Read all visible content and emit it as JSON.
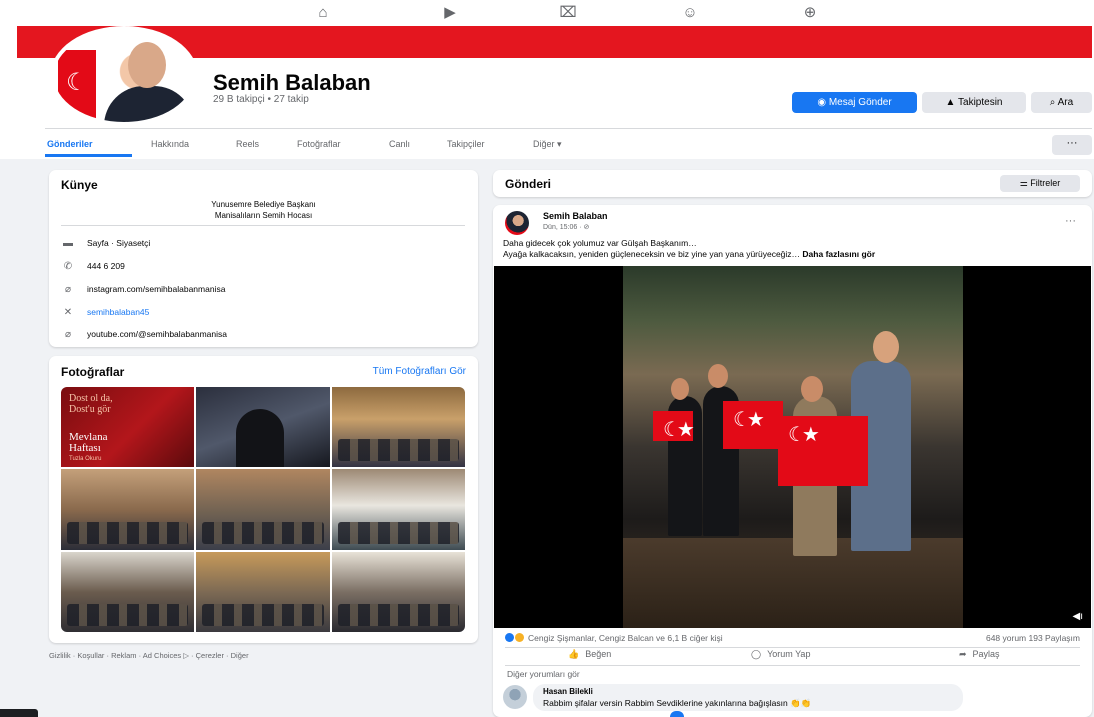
{
  "topnav": {
    "icons": [
      "home-icon",
      "video-icon",
      "marketplace-icon",
      "groups-icon",
      "gaming-icon"
    ]
  },
  "profile": {
    "name": "Semih Balaban",
    "stats": "29 B takipçi • 27 takip",
    "cover_color": "#e4161f"
  },
  "actions": {
    "message": "Mesaj Gönder",
    "following": "Takiptesin",
    "search": "Ara"
  },
  "tabs": [
    "Gönderiler",
    "Hakkında",
    "Reels",
    "Fotoğraflar",
    "Canlı",
    "Takipçiler",
    "Diğer ▾"
  ],
  "about": {
    "title": "Künye",
    "bio_line1": "Yunusemre Belediye Başkanı",
    "bio_line2": "Manisalıların Semih Hocası",
    "rows": [
      {
        "icon": "briefcase-icon",
        "text": "Sayfa · Siyasetçi"
      },
      {
        "icon": "phone-icon",
        "text": "444 6 209"
      },
      {
        "icon": "link-icon",
        "text": "instagram.com/semihbalabanmanisa"
      },
      {
        "icon": "x-icon",
        "text": "semihbalaban45"
      },
      {
        "icon": "link-icon",
        "text": "youtube.com/@semihbalabanmanisa"
      }
    ]
  },
  "photos": {
    "title": "Fotoğraflar",
    "see_all": "Tüm Fotoğrafları Gör",
    "poster_line1": "Dost ol da,",
    "poster_line2": "Dost'u gör",
    "poster_title1": "Mevlana",
    "poster_title2": "Haftası",
    "poster_sub": "Tuzla Okuru"
  },
  "footer": "Gizlilik · Koşullar · Reklam · Ad Choices ▷ · Çerezler · Diğer",
  "posts": {
    "title": "Gönderi",
    "filters": "Filtreler"
  },
  "post": {
    "author": "Semih Balaban",
    "time": "Dün, 15:06 · ⊘",
    "line1": "Daha gidecek çok yolumuz var Gülşah Başkanım…",
    "line2": "Ayağa kalkacaksın, yeniden güçleneceksin ve biz yine yan yana yürüyeceğiz…",
    "see_more": "Daha fazlasını gör",
    "reactions": "Cengiz Şişmanlar, Cengiz Balcan ve 6,1 B ciğer kişi",
    "counts": "648 yorum  193 Paylaşım",
    "like": "Beğen",
    "comment": "Yorum Yap",
    "share": "Paylaş",
    "see_comments": "Diğer yorumları gör",
    "commenter": "Hasan Bilekli",
    "comment_text": "Rabbim şifalar versin Rabbim Sevdiklerine yakınlarına bağışlasın 👏👏"
  }
}
